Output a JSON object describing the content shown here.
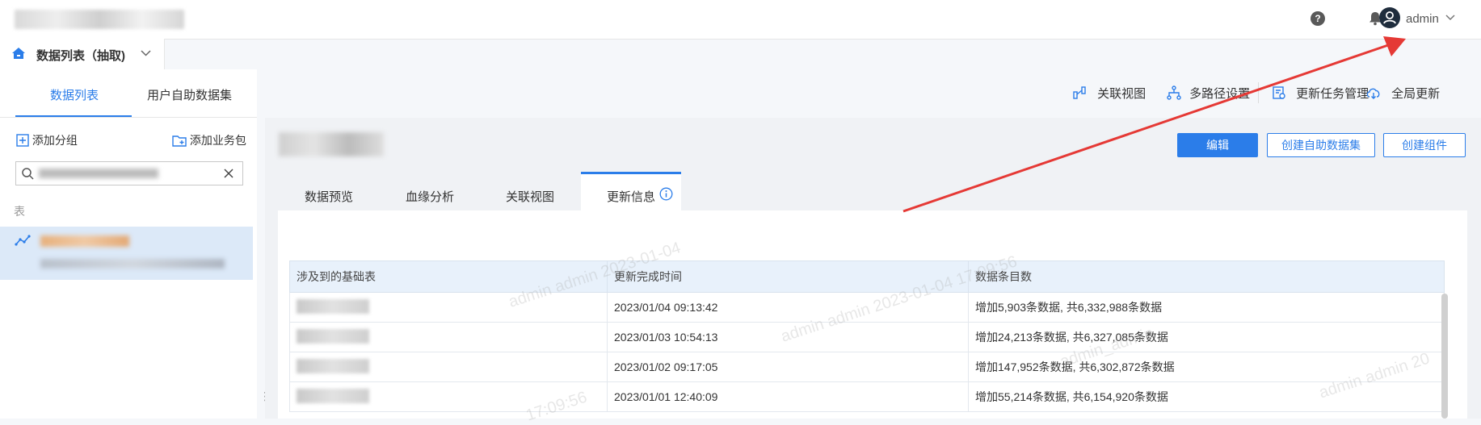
{
  "header": {
    "user": "admin"
  },
  "datasource": {
    "label": "数据列表（抽取)"
  },
  "left_tabs": [
    "数据列表",
    "用户自助数据集"
  ],
  "left_actions": {
    "add_group": "添加分组",
    "add_package": "添加业务包"
  },
  "section_label": "表",
  "toolbar": {
    "relation_view": "关联视图",
    "multi_path": "多路径设置",
    "update_tasks": "更新任务管理",
    "global_update": "全局更新"
  },
  "buttons": {
    "edit": "编辑",
    "create_dataset": "创建自助数据集",
    "create_component": "创建组件"
  },
  "main_tabs": [
    "数据预览",
    "血缘分析",
    "关联视图",
    "更新信息"
  ],
  "table": {
    "columns": [
      "涉及到的基础表",
      "更新完成时间",
      "数据条目数"
    ],
    "rows": [
      {
        "time": "2023/01/04 09:13:42",
        "count": "增加5,903条数据, 共6,332,988条数据"
      },
      {
        "time": "2023/01/03 10:54:13",
        "count": "增加24,213条数据, 共6,327,085条数据"
      },
      {
        "time": "2023/01/02 09:17:05",
        "count": "增加147,952条数据, 共6,302,872条数据"
      },
      {
        "time": "2023/01/01 12:40:09",
        "count": "增加55,214条数据, 共6,154,920条数据"
      }
    ]
  },
  "watermark": {
    "texts": [
      "admin admin 2023-01-04",
      "admin admin 2023-01-04 17:09:56",
      "admin admin 20",
      "17:09:56",
      "admin_admin"
    ]
  },
  "colors": {
    "accent": "#2b7de9",
    "arrow": "#e53935",
    "selected_bg": "#dce9f8"
  }
}
